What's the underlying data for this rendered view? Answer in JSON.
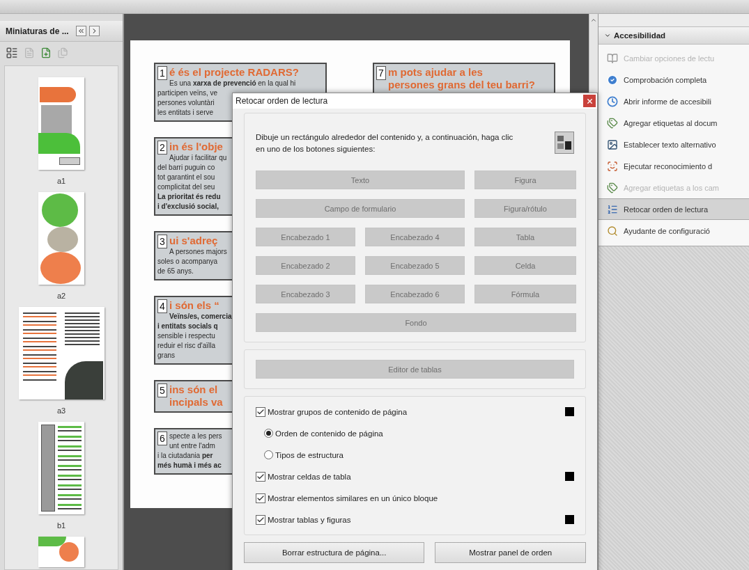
{
  "thumbnails_panel": {
    "title": "Miniaturas de ...",
    "thumbnails": [
      {
        "label": "a1",
        "kind": "cover"
      },
      {
        "label": "a2",
        "kind": "circles"
      },
      {
        "label": "a3",
        "kind": "spread"
      },
      {
        "label": "b1",
        "kind": "layout"
      },
      {
        "kind": "partial"
      }
    ]
  },
  "document": {
    "columns": [
      {
        "boxes": [
          {
            "number": "1",
            "heading": [
              "é és el projecte RADARS?"
            ],
            "body": [
              "Es una **xarxa de prevenció** en la qual hi",
              "participen veïns, ve",
              "persones voluntàri",
              "les entitats i serve"
            ]
          },
          {
            "number": "2",
            "heading": [
              "in és l'obje"
            ],
            "body": [
              "Ajudar i facilitar qu",
              "del barri puguin co",
              "tot garantint el sou",
              "complicitat del seu",
              "**La prioritat és redu**",
              "**i d'exclusió social,**"
            ]
          },
          {
            "number": "3",
            "heading": [
              "ui s'adreç"
            ],
            "body": [
              "A persones majors",
              "soles o acompanya",
              "de 65 anys."
            ]
          },
          {
            "number": "4",
            "heading": [
              "i són els “"
            ],
            "body": [
              "**Veïns/es, comercia**",
              "**i entitats socials q**",
              "sensible i respectu",
              "reduir el risc d'aïlla",
              "grans"
            ]
          },
          {
            "number": "5",
            "heading": [
              "ins són el",
              "incipals va"
            ]
          },
          {
            "number": "6",
            "body": [
              "specte a les pers",
              "unt entre l'adm",
              "i la ciutadania **per**",
              "**més humà i més ac**"
            ]
          }
        ]
      },
      {
        "boxes": [
          {
            "number": "7",
            "heading": [
              "m pots ajudar a les",
              "persones grans del teu barri?"
            ]
          }
        ]
      }
    ]
  },
  "accessibility_panel": {
    "title": "Accesibilidad",
    "expanded": true,
    "items": [
      {
        "label": "Cambiar opciones de lectu",
        "kind": "book",
        "disabled": true,
        "selected": false
      },
      {
        "label": "Comprobación completa",
        "kind": "check",
        "disabled": false,
        "selected": false
      },
      {
        "label": "Abrir informe de accesibili",
        "kind": "report",
        "disabled": false,
        "selected": false
      },
      {
        "label": "Agregar etiquetas al docum",
        "kind": "tags",
        "disabled": false,
        "selected": false
      },
      {
        "label": "Establecer texto alternativo",
        "kind": "image",
        "disabled": false,
        "selected": false
      },
      {
        "label": "Ejecutar reconocimiento d",
        "kind": "scan",
        "disabled": false,
        "selected": false
      },
      {
        "label": "Agregar etiquetas a los cam",
        "kind": "tags",
        "disabled": true,
        "selected": false
      },
      {
        "label": "Retocar orden de lectura",
        "kind": "order",
        "disabled": false,
        "selected": true
      },
      {
        "label": "Ayudante de configuració",
        "kind": "wizard",
        "disabled": false,
        "selected": false
      }
    ]
  },
  "dialog": {
    "title": "Retocar orden de lectura",
    "instruction": "Dibuje un rectángulo alrededor del contenido y, a continuación, haga clic en uno de los botones siguientes:",
    "tag_buttons": [
      {
        "label": "Texto",
        "kind": "wide",
        "disabled": true
      },
      {
        "label": "Figura",
        "kind": "single",
        "disabled": true
      },
      {
        "label": "Campo de formulario",
        "kind": "wide",
        "disabled": true
      },
      {
        "label": "Figura/rótulo",
        "kind": "single",
        "disabled": true
      },
      {
        "label": "Encabezado 1",
        "kind": "single",
        "disabled": true
      },
      {
        "label": "Encabezado 4",
        "kind": "single",
        "disabled": true
      },
      {
        "label": "Tabla",
        "kind": "single",
        "disabled": true
      },
      {
        "label": "Encabezado 2",
        "kind": "single",
        "disabled": true
      },
      {
        "label": "Encabezado 5",
        "kind": "single",
        "disabled": true
      },
      {
        "label": "Celda",
        "kind": "single",
        "disabled": true
      },
      {
        "label": "Encabezado 3",
        "kind": "single",
        "disabled": true
      },
      {
        "label": "Encabezado 6",
        "kind": "single",
        "disabled": true
      },
      {
        "label": "Fórmula",
        "kind": "single",
        "disabled": true
      },
      {
        "label": "Fondo",
        "kind": "full",
        "disabled": true
      }
    ],
    "table_editor": {
      "label": "Editor de tablas",
      "disabled": true
    },
    "options": [
      {
        "kind": "checkbox",
        "label": "Mostrar grupos de contenido de página",
        "checked": true,
        "color": "#000000"
      },
      {
        "kind": "radio",
        "label": "Orden de contenido de página",
        "selected": true
      },
      {
        "kind": "radio",
        "label": "Tipos de estructura",
        "selected": false
      },
      {
        "kind": "checkbox",
        "label": "Mostrar celdas de tabla",
        "checked": true,
        "color": "#000000"
      },
      {
        "kind": "checkbox",
        "label": "Mostrar elementos similares en un único bloque",
        "checked": true
      },
      {
        "kind": "checkbox",
        "label": "Mostrar tablas y figuras",
        "checked": true,
        "color": "#000000"
      }
    ],
    "buttons": [
      "Borrar estructura de página...",
      "Mostrar panel de orden"
    ]
  }
}
